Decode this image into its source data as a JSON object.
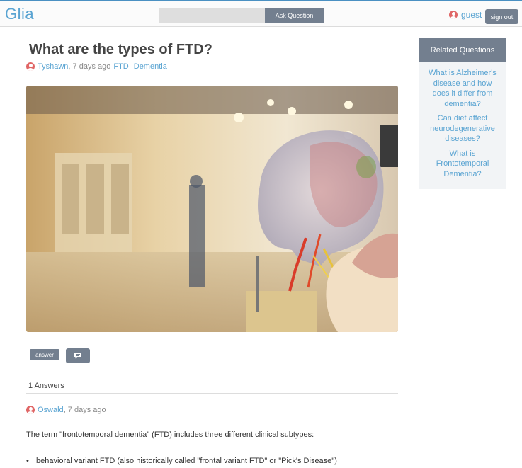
{
  "header": {
    "logo": "Glia",
    "search_value": "",
    "ask_label": "Ask Question",
    "user_name": "guest",
    "signout_label": "sign out"
  },
  "question": {
    "title": "What are the types of FTD?",
    "author": "Tyshawn",
    "time": ", 7 days ago",
    "tags": [
      "FTD",
      "Dementia"
    ],
    "image_icon": "brain-model-photo"
  },
  "actions": {
    "answer_label": "answer",
    "comment_icon": "comment-icon"
  },
  "answers": {
    "count_label": "1 Answers",
    "items": [
      {
        "author": "Oswald",
        "time": ", 7 days ago",
        "body": "The term \"frontotemporal dementia\" (FTD) includes three different clinical subtypes:",
        "list": [
          "behavioral variant FTD (also historically called \"frontal variant FTD\" or \"Pick's Disease\")"
        ]
      }
    ]
  },
  "sidebar": {
    "title": "Related Questions",
    "items": [
      "What is Alzheimer's disease and how does it differ from dementia?",
      "Can diet affect neurodegenerative diseases?",
      "What is Frontotemporal Dementia?"
    ]
  },
  "colors": {
    "accent": "#5aa4d2",
    "button": "#737f8f",
    "avatar": "#e06666"
  }
}
